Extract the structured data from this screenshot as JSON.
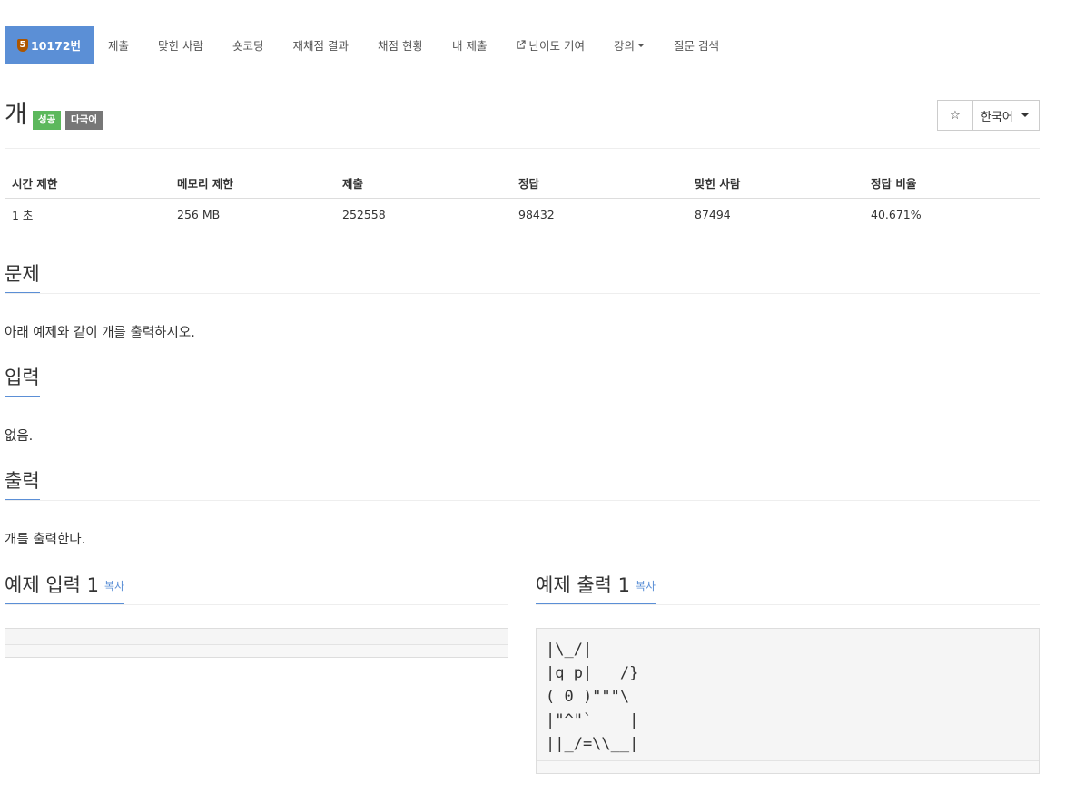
{
  "nav": {
    "problem_tab": {
      "tier": "5",
      "label": "10172번"
    },
    "items": [
      {
        "label": "제출"
      },
      {
        "label": "맞힌 사람"
      },
      {
        "label": "숏코딩"
      },
      {
        "label": "재채점 결과"
      },
      {
        "label": "채점 현황"
      },
      {
        "label": "내 제출"
      },
      {
        "label": "난이도 기여"
      },
      {
        "label": "강의"
      },
      {
        "label": "질문 검색"
      }
    ]
  },
  "problem": {
    "title": "개",
    "labels": [
      "성공",
      "다국어"
    ],
    "star_symbol": "☆",
    "language": "한국어"
  },
  "stats": {
    "headers": [
      "시간 제한",
      "메모리 제한",
      "제출",
      "정답",
      "맞힌 사람",
      "정답 비율"
    ],
    "values": [
      "1 초",
      "256 MB",
      "252558",
      "98432",
      "87494",
      "40.671%"
    ]
  },
  "sections": {
    "description": {
      "title": "문제",
      "text": "아래 예제와 같이 개를 출력하시오."
    },
    "input": {
      "title": "입력",
      "text": "없음."
    },
    "output": {
      "title": "출력",
      "text": "개를 출력한다."
    }
  },
  "samples": {
    "input": {
      "title": "예제 입력 1",
      "copy": "복사",
      "content": ""
    },
    "output": {
      "title": "예제 출력 1",
      "copy": "복사",
      "content": "|\\_/|\n|q p|   /}\n( 0 )\"\"\"\\\n|\"^\"`    |\n||_/=\\\\__|"
    }
  }
}
